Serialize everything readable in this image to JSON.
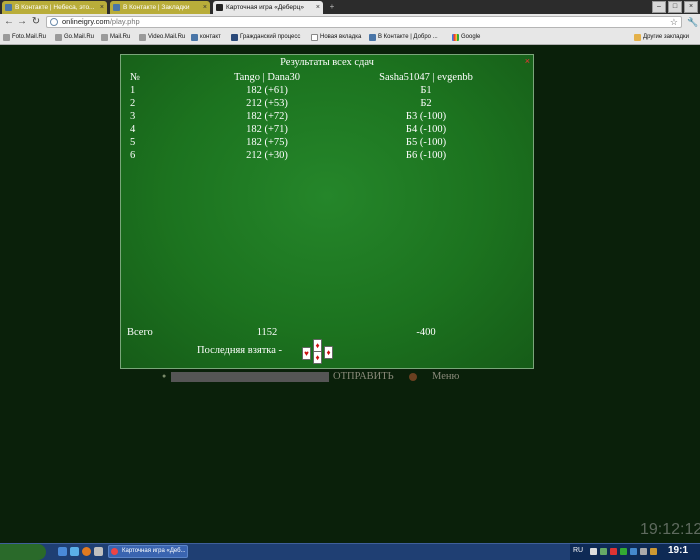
{
  "browser": {
    "tabs": [
      {
        "label": "В Контакте | Небеса, это...",
        "active": false
      },
      {
        "label": "В Контакте | Закладки",
        "active": false
      },
      {
        "label": "Карточная игра «Деберц»",
        "active": true
      }
    ],
    "url_host": "onlineigry.com",
    "url_path": "/play.php",
    "bookmarks": [
      {
        "label": "Foto.Mail.Ru",
        "icon": "mailru-icon"
      },
      {
        "label": "Go.Mail.Ru",
        "icon": "mailru-icon"
      },
      {
        "label": "Mail.Ru",
        "icon": "mailru-icon"
      },
      {
        "label": "Video.Mail.Ru",
        "icon": "mailru-icon"
      },
      {
        "label": "контакт",
        "icon": "vk-icon"
      },
      {
        "label": "Гражданский процесс",
        "icon": "t-icon"
      },
      {
        "label": "Новая вкладка",
        "icon": "page-icon"
      },
      {
        "label": "В Контакте | Добро ...",
        "icon": "vk-icon"
      },
      {
        "label": "Google",
        "icon": "google-icon"
      }
    ],
    "other_bookmarks": "Другие закладки"
  },
  "results": {
    "title": "Результаты всех сдач",
    "close_symbol": "×",
    "col_no": "№",
    "team_a": "Tango | Dana30",
    "team_b": "Sasha51047 | evgenbb",
    "rows": [
      {
        "no": "1",
        "a": "182 (+61)",
        "b": "Б1"
      },
      {
        "no": "2",
        "a": "212 (+53)",
        "b": "Б2"
      },
      {
        "no": "3",
        "a": "182 (+72)",
        "b": "Б3 (-100)"
      },
      {
        "no": "4",
        "a": "182 (+71)",
        "b": "Б4 (-100)"
      },
      {
        "no": "5",
        "a": "182 (+75)",
        "b": "Б5 (-100)"
      },
      {
        "no": "6",
        "a": "212 (+30)",
        "b": "Б6 (-100)"
      }
    ],
    "total_label": "Всего",
    "total_a": "1152",
    "total_b": "-400",
    "last_trick_label": "Последняя взятка -",
    "last_trick_suits": [
      "♥",
      "♦",
      "♦",
      "♦"
    ]
  },
  "chat": {
    "send_label": "ОТПРАВИТЬ",
    "menu_label": "Меню"
  },
  "overlay_clock": "19:12:12",
  "taskbar": {
    "task_label": "Карточная игра «Деб...",
    "lang": "RU",
    "clock": "19:1"
  },
  "colors": {
    "felt": "#1d7a1f",
    "background": "#0a200a",
    "close": "#e33333"
  }
}
